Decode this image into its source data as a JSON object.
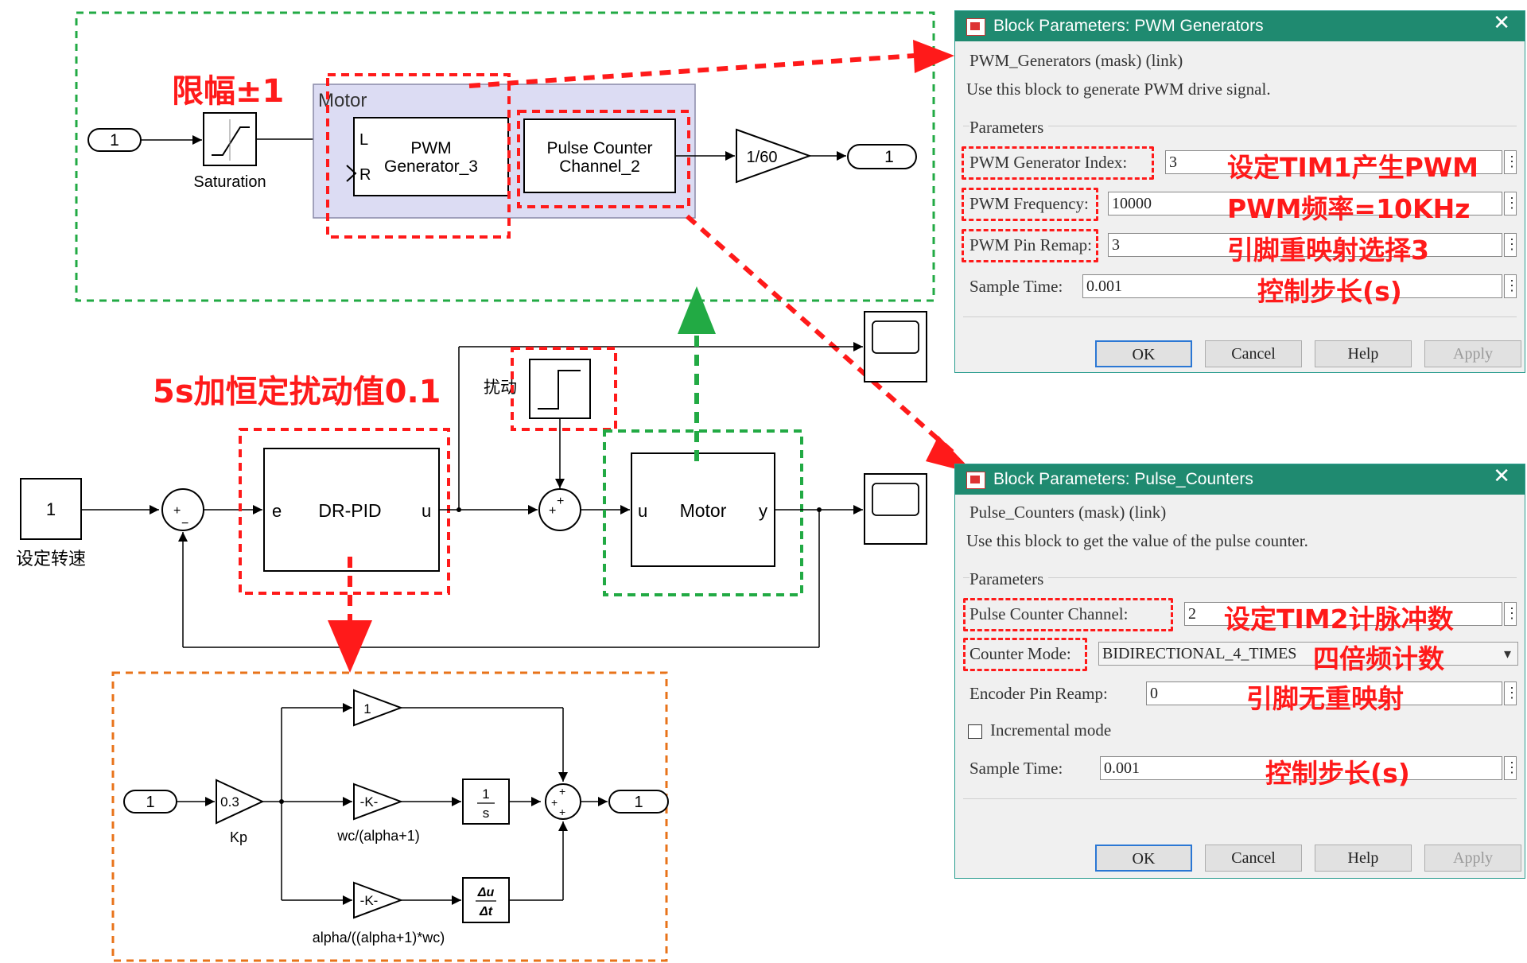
{
  "top_subsystem": {
    "inport": "1",
    "saturation_label": "Saturation",
    "annotation_limit": "限幅±1",
    "motor_group_title": "Motor",
    "pwm_port_l": "L",
    "pwm_port_r": "R",
    "pwm_block_line1": "PWM",
    "pwm_block_line2": "Generator_3",
    "pulse_block_line1": "Pulse Counter",
    "pulse_block_line2": "Channel_2",
    "gain": "1/60",
    "outport": "1"
  },
  "main_loop": {
    "setpoint_value": "1",
    "setpoint_label": "设定转速",
    "sum_plus": "+",
    "sum_minus": "−",
    "pid_port_e": "e",
    "pid_label": "DR-PID",
    "pid_port_u": "u",
    "disturbance_label": "扰动",
    "annotation_disturbance": "5s加恒定扰动值0.1",
    "motor_port_u": "u",
    "motor_label": "Motor",
    "motor_port_y": "y"
  },
  "pid_detail": {
    "inport": "1",
    "gain_top": "1",
    "kp_value": "0.3",
    "kp_label": "Kp",
    "gain_mid": "-K-",
    "gain_mid_label": "wc/(alpha+1)",
    "integrator_num": "1",
    "integrator_den": "s",
    "gain_bot": "-K-",
    "gain_bot_label": "alpha/((alpha+1)*wc)",
    "deriv_num": "Δu",
    "deriv_den": "Δt",
    "outport": "1"
  },
  "dialog_pwm": {
    "title": "Block Parameters: PWM Generators",
    "close": "✕",
    "header_line": "PWM_Generators (mask) (link)",
    "description": "Use this block to generate PWM drive signal.",
    "group": "Parameters",
    "params": [
      {
        "label": "PWM Generator Index:",
        "value": "3",
        "note": "设定TIM1产生PWM"
      },
      {
        "label": "PWM Frequency:",
        "value": "10000",
        "note": "PWM频率=10KHz"
      },
      {
        "label": "PWM Pin Remap:",
        "value": "3",
        "note": "引脚重映射选择3"
      },
      {
        "label": "Sample Time:",
        "value": "0.001",
        "note": "控制步长(s)"
      }
    ],
    "ellipsis": "⋮",
    "buttons": {
      "ok": "OK",
      "cancel": "Cancel",
      "help": "Help",
      "apply": "Apply"
    }
  },
  "dialog_pulse": {
    "title": "Block Parameters: Pulse_Counters",
    "close": "✕",
    "header_line": "Pulse_Counters (mask) (link)",
    "description": "Use this block to get the value of the pulse counter.",
    "group": "Parameters",
    "params": [
      {
        "label": "Pulse Counter Channel:",
        "value": "2",
        "note": "设定TIM2计脉冲数"
      },
      {
        "label": "Counter Mode:",
        "value": "BIDIRECTIONAL_4_TIMES",
        "note": "四倍频计数"
      },
      {
        "label": "Encoder Pin Reamp:",
        "value": "0",
        "note": "引脚无重映射"
      },
      {
        "label": "Sample Time:",
        "value": "0.001",
        "note": "控制步长(s)"
      }
    ],
    "checkbox_label": "Incremental mode",
    "ellipsis": "⋮",
    "buttons": {
      "ok": "OK",
      "cancel": "Cancel",
      "help": "Help",
      "apply": "Apply"
    }
  },
  "colors": {
    "annotation_red": "#ff1a1a",
    "green_dash": "#22aa44",
    "orange_dash": "#e8731a",
    "title_bar": "#1f8a70"
  }
}
